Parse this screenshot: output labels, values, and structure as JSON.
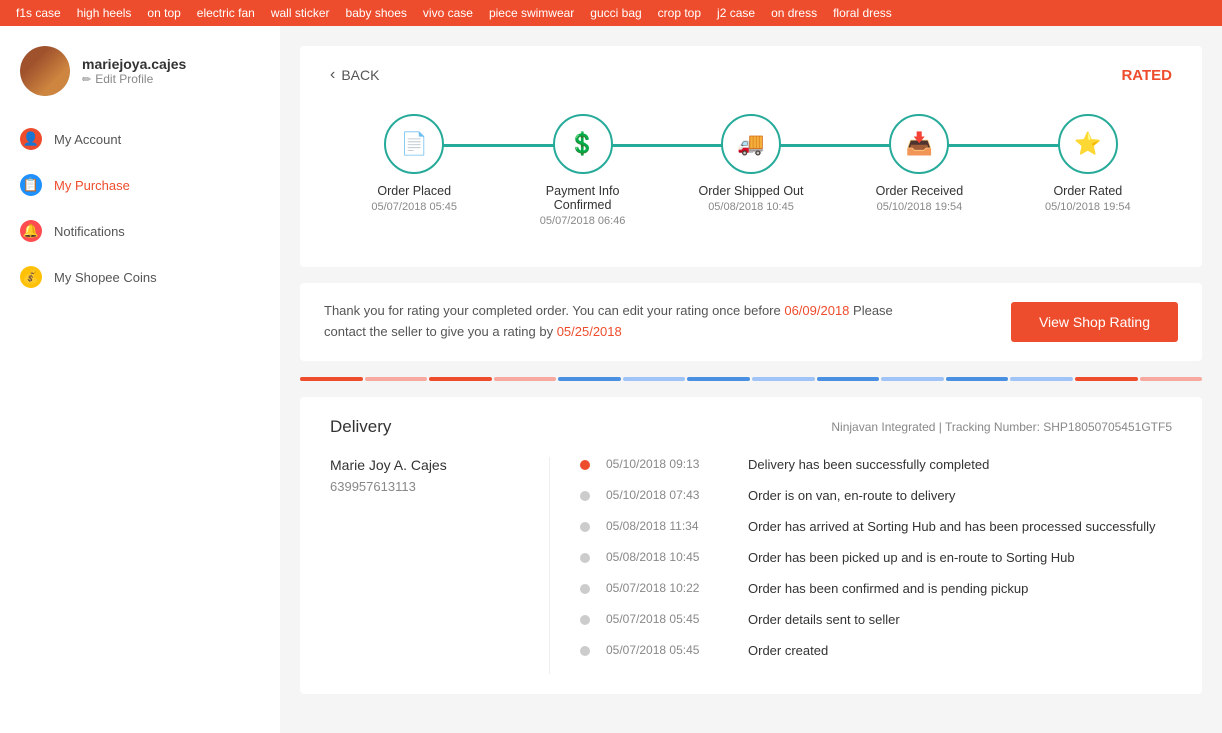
{
  "topbar": {
    "items": [
      "f1s case",
      "high heels",
      "on top",
      "electric fan",
      "wall sticker",
      "baby shoes",
      "vivo case",
      "piece swimwear",
      "gucci bag",
      "crop top",
      "j2 case",
      "on dress",
      "floral dress"
    ]
  },
  "sidebar": {
    "username": "mariejoya.cajes",
    "edit_profile_label": "Edit Profile",
    "nav": [
      {
        "id": "my-account",
        "label": "My Account",
        "icon": "👤",
        "iconType": "orange"
      },
      {
        "id": "my-purchase",
        "label": "My Purchase",
        "icon": "📋",
        "iconType": "blue",
        "active": true
      },
      {
        "id": "notifications",
        "label": "Notifications",
        "icon": "🔔",
        "iconType": "red"
      },
      {
        "id": "my-shopee-coins",
        "label": "My Shopee Coins",
        "icon": "💰",
        "iconType": "gold"
      }
    ]
  },
  "order_header": {
    "back_label": "BACK",
    "rated_label": "RATED"
  },
  "steps": [
    {
      "id": "order-placed",
      "label": "Order Placed",
      "date": "05/07/2018 05:45",
      "icon": "📄"
    },
    {
      "id": "payment-confirmed",
      "label": "Payment Info\nConfirmed",
      "date": "05/07/2018 06:46",
      "icon": "💲"
    },
    {
      "id": "order-shipped",
      "label": "Order Shipped Out",
      "date": "05/08/2018 10:45",
      "icon": "🚚"
    },
    {
      "id": "order-received",
      "label": "Order Received",
      "date": "05/10/2018 19:54",
      "icon": "📥"
    },
    {
      "id": "order-rated",
      "label": "Order Rated",
      "date": "05/10/2018 19:54",
      "icon": "⭐"
    }
  ],
  "rating_notice": {
    "text1": "Thank you for rating your completed order. You can edit your rating once before ",
    "date1": "06/09/2018",
    "text2": " Please contact the seller to give you a rating by ",
    "date2": "05/25/2018",
    "button_label": "View Shop Rating"
  },
  "color_tabs": [
    "#ee4d2d",
    "#f7a9a0",
    "#ee4d2d",
    "#f7a9a0",
    "#4a90e2",
    "#a0c4f7",
    "#4a90e2",
    "#a0c4f7",
    "#4a90e2",
    "#a0c4f7",
    "#4a90e2",
    "#a0c4f7",
    "#ee4d2d",
    "#f7a9a0"
  ],
  "delivery": {
    "title": "Delivery",
    "tracking": "Ninjavan Integrated | Tracking Number: SHP18050705451GTF5",
    "recipient_name": "Marie Joy A. Cajes",
    "recipient_phone": "639957613113",
    "timeline": [
      {
        "time": "05/10/2018 09:13",
        "event": "Delivery has been successfully completed",
        "active": true
      },
      {
        "time": "05/10/2018 07:43",
        "event": "Order is on van, en-route to delivery",
        "active": false
      },
      {
        "time": "05/08/2018 11:34",
        "event": "Order has arrived at Sorting Hub and has been processed successfully",
        "active": false
      },
      {
        "time": "05/08/2018 10:45",
        "event": "Order has been picked up and is en-route to Sorting Hub",
        "active": false
      },
      {
        "time": "05/07/2018 10:22",
        "event": "Order has been confirmed and is pending pickup",
        "active": false
      },
      {
        "time": "05/07/2018 05:45",
        "event": "Order details sent to seller",
        "active": false
      },
      {
        "time": "05/07/2018 05:45",
        "event": "Order created",
        "active": false
      }
    ]
  }
}
